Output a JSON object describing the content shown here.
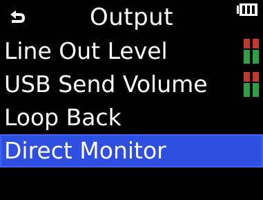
{
  "header": {
    "title": "Output",
    "back_icon": "back-arrow-icon",
    "battery_icon": "battery-icon"
  },
  "menu": {
    "items": [
      {
        "label": "Line Out Level",
        "has_meter": true,
        "selected": false
      },
      {
        "label": "USB Send Volume",
        "has_meter": true,
        "selected": false
      },
      {
        "label": "Loop Back",
        "has_meter": false,
        "selected": false
      },
      {
        "label": "Direct Monitor",
        "has_meter": false,
        "selected": true
      }
    ]
  },
  "colors": {
    "background": "#000000",
    "text": "#ffffff",
    "selection": "#2e4fe0",
    "meter_red": "#c0392b",
    "meter_green": "#2ea043"
  }
}
